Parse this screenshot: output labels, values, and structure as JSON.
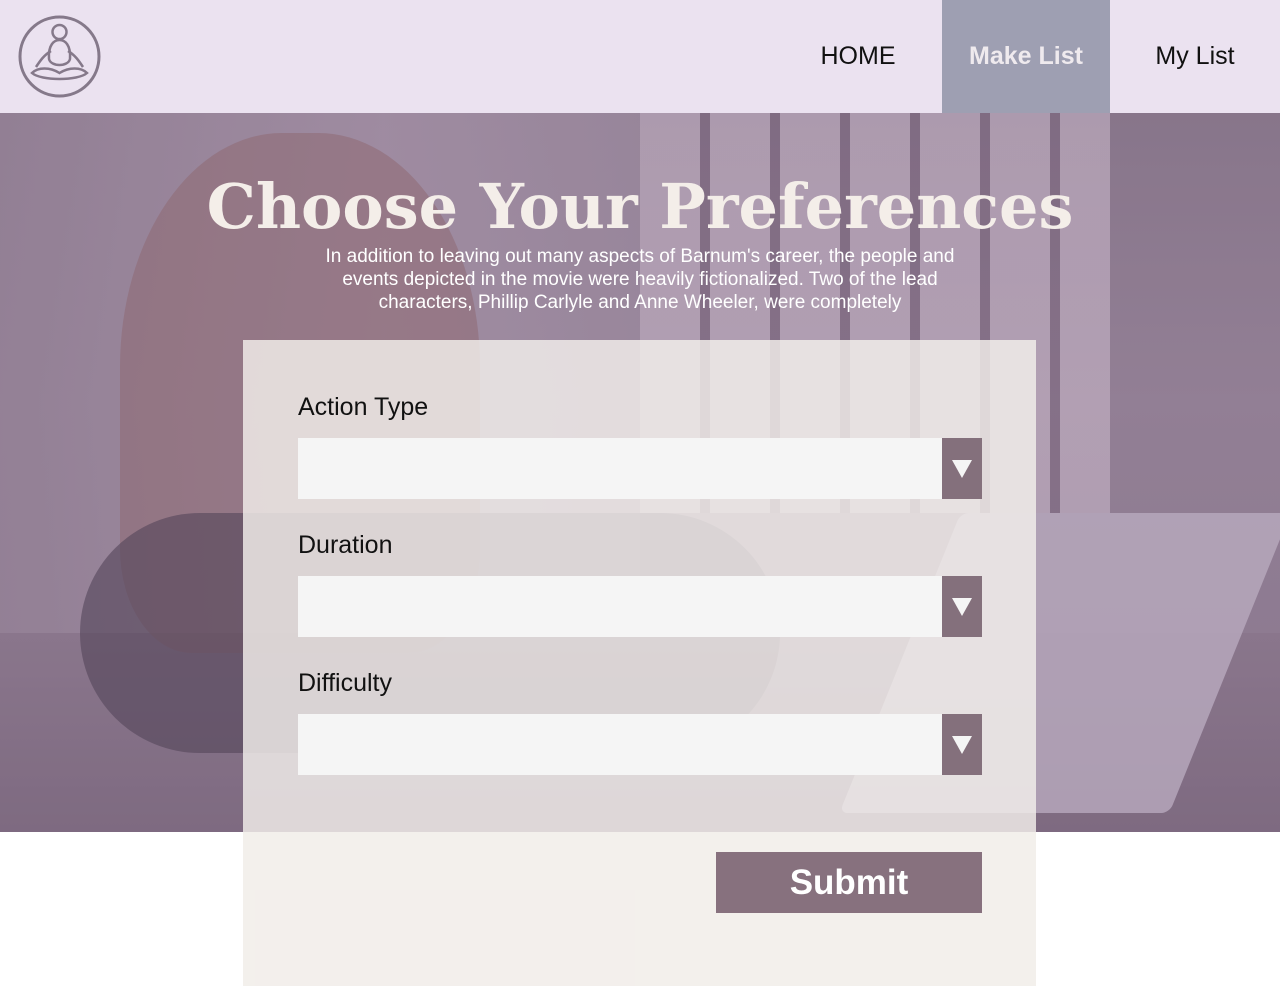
{
  "nav": {
    "home": "HOME",
    "make_list": "Make List",
    "my_list": "My List",
    "active": "Make List"
  },
  "hero": {
    "title": "Choose Your Preferences",
    "description": "In addition to leaving out many aspects of Barnum's career, the people and events depicted in the movie were heavily fictionalized. Two of the lead characters, Phillip Carlyle and Anne Wheeler, were completely"
  },
  "form": {
    "action_type": {
      "label": "Action Type",
      "value": ""
    },
    "duration": {
      "label": "Duration",
      "value": ""
    },
    "difficulty": {
      "label": "Difficulty",
      "value": ""
    },
    "submit_label": "Submit"
  },
  "icons": {
    "logo": "meditation-logo-icon",
    "dropdown": "triangle-down-icon"
  },
  "colors": {
    "header_bg": "#ebe2f0",
    "nav_active_bg": "#9e9fb2",
    "accent": "#87717e",
    "card_bg": "#f4f0ed",
    "select_bg": "#f5f5f5"
  }
}
